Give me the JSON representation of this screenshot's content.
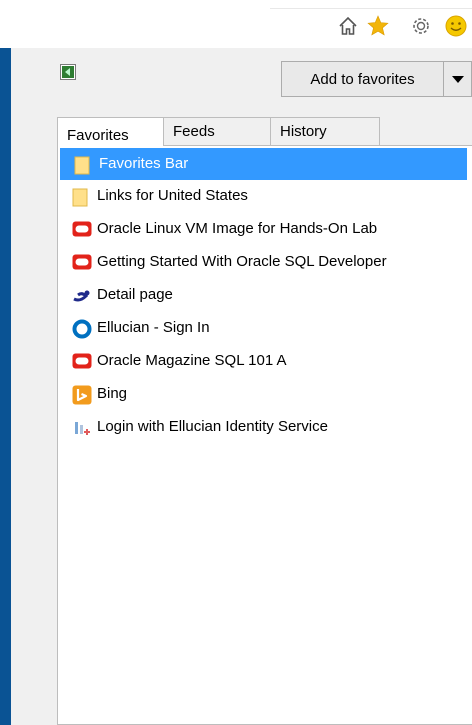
{
  "toolbar": {
    "icons": [
      "home-icon",
      "star-icon",
      "gear-icon",
      "smiley-icon"
    ],
    "colors": {
      "star": "#f2b50a",
      "smiley": "#f5c800"
    }
  },
  "panel": {
    "add_to_favorites_label": "Add to favorites",
    "tabs": [
      {
        "label": "Favorites",
        "active": true
      },
      {
        "label": "Feeds",
        "active": false
      },
      {
        "label": "History",
        "active": false
      }
    ],
    "items": [
      {
        "label": "Favorites Bar",
        "icon": "folder-icon",
        "selected": true
      },
      {
        "label": "Links for United States",
        "icon": "folder-icon",
        "selected": false
      },
      {
        "label": "Oracle Linux VM Image for Hands-On Lab",
        "icon": "oracle-icon",
        "selected": false
      },
      {
        "label": "Getting Started With Oracle SQL Developer",
        "icon": "oracle-icon",
        "selected": false
      },
      {
        "label": "Detail page",
        "icon": "ellucian-logo-icon",
        "selected": false
      },
      {
        "label": "Ellucian - Sign In",
        "icon": "ellucian-circle-icon",
        "selected": false
      },
      {
        "label": "Oracle Magazine SQL 101 A",
        "icon": "oracle-icon",
        "selected": false
      },
      {
        "label": "Bing",
        "icon": "bing-icon",
        "selected": false
      },
      {
        "label": "Login with Ellucian Identity Service",
        "icon": "ellucian-identity-icon",
        "selected": false
      }
    ]
  },
  "colors": {
    "side_strip": "#0a5394",
    "selection": "#3399ff",
    "oracle_red": "#e2231a",
    "bing_orange": "#f29b1d",
    "ellucian_blue": "#0070c0"
  }
}
